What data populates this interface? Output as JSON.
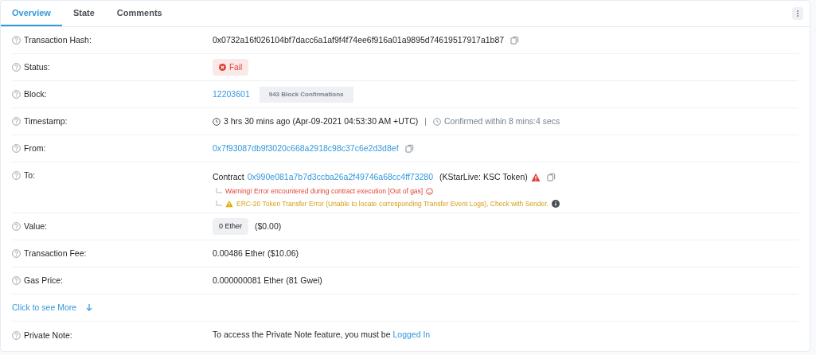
{
  "tabs": [
    {
      "label": "Overview",
      "selected": true
    },
    {
      "label": "State",
      "selected": false
    },
    {
      "label": "Comments",
      "selected": false
    }
  ],
  "rows": [
    {
      "kind": "copy_text",
      "label": "Transaction Hash:",
      "value": "0x0732a16f026104bf7dacc6a1af9f4f74ee6f916a01a9895d74619517917a1b87"
    },
    {
      "kind": "status",
      "label": "Status:",
      "badge": "Fail"
    },
    {
      "kind": "block",
      "label": "Block:",
      "link": "12203601",
      "badge": "943 Block Confirmations"
    },
    {
      "kind": "timestamp",
      "label": "Timestamp:",
      "age": "3 hrs 30 mins ago (Apr-09-2021 04:53:30 AM +UTC)",
      "separator": "|",
      "confirmed": "Confirmed within 8 mins:4 secs"
    },
    {
      "kind": "copy_link",
      "label": "From:",
      "link": "0x7f93087db9f3020c668a2918c98c37c6e2d3d8ef"
    },
    {
      "kind": "contract",
      "label": "To:",
      "prefix": "Contract",
      "link": "0x990e081a7b7d3ccba26a2f49746a68cc4ff73280",
      "name": "(KStarLive: KSC Token)",
      "warning": "Warning! Error encountered during contract execution [Out of gas]",
      "notice": "ERC-20 Token Transfer Error (Unable to locate corresponding Transfer Event Logs), Check with Sender."
    },
    {
      "kind": "value",
      "label": "Value:",
      "badge": "0 Ether",
      "text": "($0.00)"
    },
    {
      "kind": "text",
      "label": "Transaction Fee:",
      "value": "0.00486 Ether ($10.06)"
    },
    {
      "kind": "text",
      "label": "Gas Price:",
      "value": "0.000000081 Ether (81 Gwei)"
    },
    {
      "kind": "more",
      "link": "Click to see More"
    },
    {
      "kind": "note",
      "label": "Private Note:",
      "text": "To access the Private Note feature, you must be",
      "link": "Logged In"
    }
  ]
}
